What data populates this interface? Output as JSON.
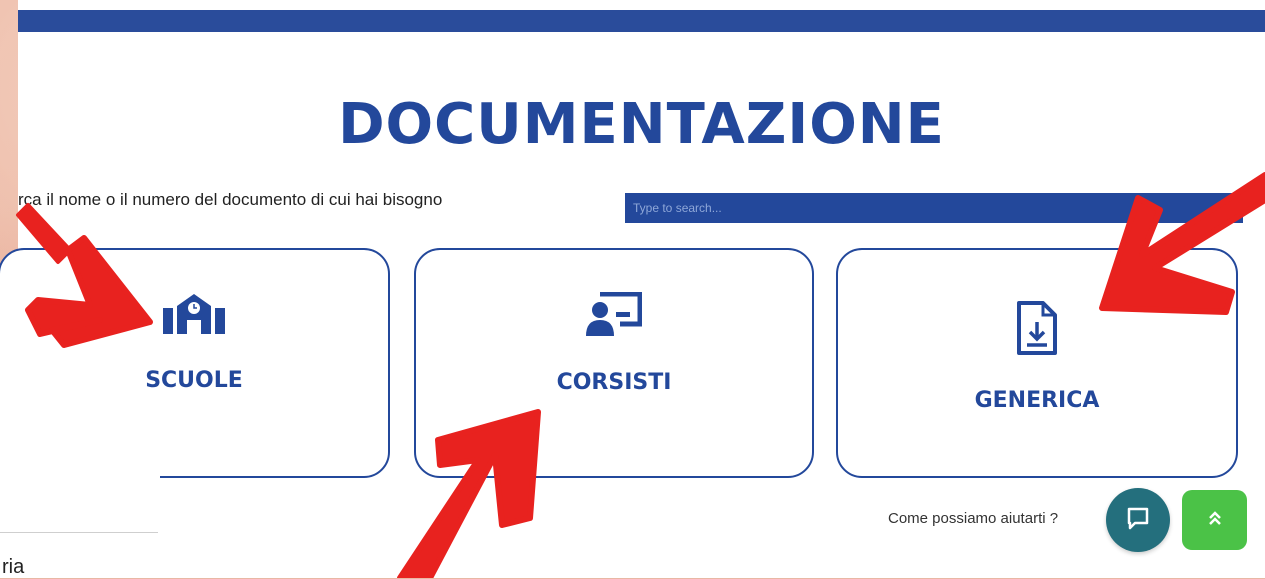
{
  "page": {
    "title": "DOCUMENTAZIONE",
    "search_hint": "rca il nome o il numero del documento di cui hai bisogno",
    "search_placeholder": "Type to search..."
  },
  "cards": [
    {
      "label": "SCUOLE",
      "icon": "school-icon"
    },
    {
      "label": "CORSISTI",
      "icon": "teacher-board-icon"
    },
    {
      "label": "GENERICA",
      "icon": "document-download-icon"
    }
  ],
  "footer": {
    "help_text": "Come possiamo aiutarti ?",
    "chat_icon": "chat-icon",
    "scroll_top_icon": "chevron-double-up-icon"
  },
  "left_panel": {
    "fragment": "ria"
  },
  "colors": {
    "brand_blue": "#23489b",
    "annotation_red": "#e8221f",
    "chat_teal": "#246f7d",
    "scroll_green": "#4bc247"
  }
}
